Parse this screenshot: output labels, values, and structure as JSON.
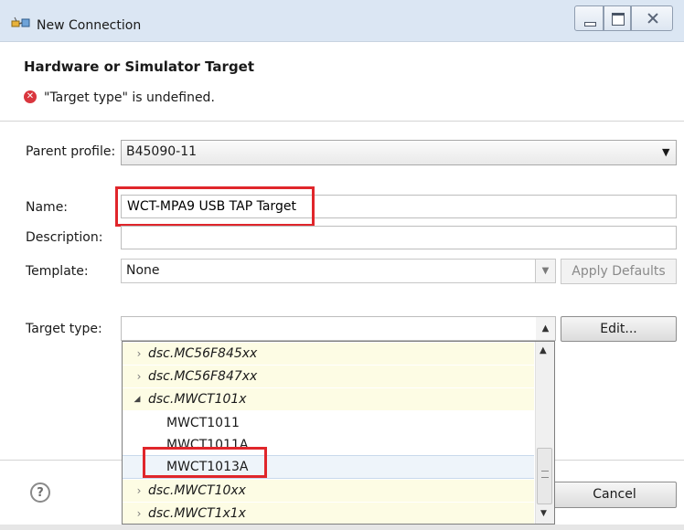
{
  "window": {
    "title": "New Connection"
  },
  "header": {
    "title": "Hardware or Simulator Target",
    "error_message": "\"Target type\" is undefined."
  },
  "form": {
    "parent_profile": {
      "label": "Parent profile:",
      "value": "B45090-11"
    },
    "name": {
      "label": "Name:",
      "value": "WCT-MPA9 USB TAP Target"
    },
    "description": {
      "label": "Description:",
      "value": ""
    },
    "template": {
      "label": "Template:",
      "value": "None",
      "apply_defaults_label": "Apply Defaults"
    },
    "target_type": {
      "label": "Target type:",
      "value": "",
      "edit_label": "Edit..."
    }
  },
  "target_list": {
    "items": [
      {
        "label": "dsc.MC56F845xx",
        "kind": "group",
        "expanded": false
      },
      {
        "label": "dsc.MC56F847xx",
        "kind": "group",
        "expanded": false
      },
      {
        "label": "dsc.MWCT101x",
        "kind": "group",
        "expanded": true
      },
      {
        "label": "MWCT1011",
        "kind": "child"
      },
      {
        "label": "MWCT1011A",
        "kind": "child"
      },
      {
        "label": "MWCT1013A",
        "kind": "child",
        "selected": true
      },
      {
        "label": "dsc.MWCT10xx",
        "kind": "group",
        "expanded": false
      },
      {
        "label": "dsc.MWCT1x1x",
        "kind": "group",
        "expanded": false
      }
    ]
  },
  "footer": {
    "help_icon": "?",
    "cancel_label": "Cancel"
  },
  "colors": {
    "highlight": "#e0262b",
    "error": "#d9363e",
    "group_row_bg": "#fdfce4",
    "titlebar": "#dbe6f3"
  },
  "icons": {
    "app": "plug-connection-icon",
    "error": "error-x-icon",
    "help": "help-question-icon"
  }
}
